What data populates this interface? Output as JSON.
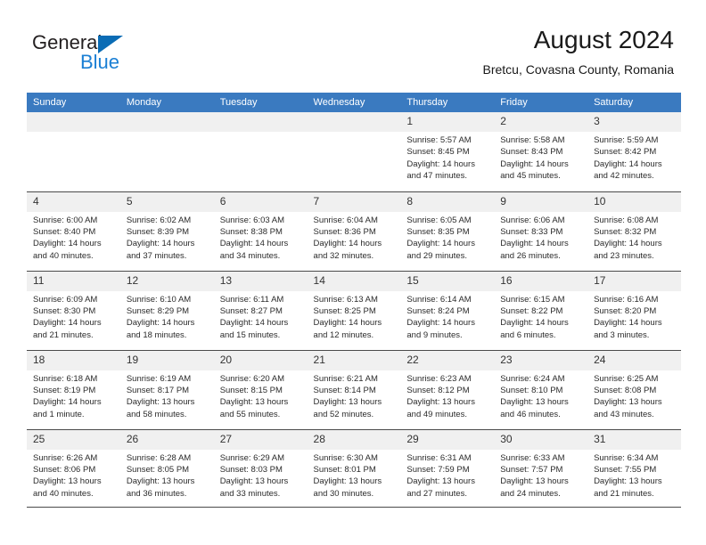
{
  "brand": {
    "name_part1": "General",
    "name_part2": "Blue",
    "triangle_color": "#0a6cb5",
    "blue_color": "#1a7fd4"
  },
  "header": {
    "title": "August 2024",
    "subtitle": "Bretcu, Covasna County, Romania"
  },
  "theme": {
    "header_bg": "#3a7ac0",
    "daynum_bg": "#f0f0f0",
    "rule_color": "#4a4a4a",
    "text_color": "#2b2b2b"
  },
  "weekdays": [
    "Sunday",
    "Monday",
    "Tuesday",
    "Wednesday",
    "Thursday",
    "Friday",
    "Saturday"
  ],
  "weeks": [
    [
      {
        "day": "",
        "lines": []
      },
      {
        "day": "",
        "lines": []
      },
      {
        "day": "",
        "lines": []
      },
      {
        "day": "",
        "lines": []
      },
      {
        "day": "1",
        "lines": [
          "Sunrise: 5:57 AM",
          "Sunset: 8:45 PM",
          "Daylight: 14 hours",
          "and 47 minutes."
        ]
      },
      {
        "day": "2",
        "lines": [
          "Sunrise: 5:58 AM",
          "Sunset: 8:43 PM",
          "Daylight: 14 hours",
          "and 45 minutes."
        ]
      },
      {
        "day": "3",
        "lines": [
          "Sunrise: 5:59 AM",
          "Sunset: 8:42 PM",
          "Daylight: 14 hours",
          "and 42 minutes."
        ]
      }
    ],
    [
      {
        "day": "4",
        "lines": [
          "Sunrise: 6:00 AM",
          "Sunset: 8:40 PM",
          "Daylight: 14 hours",
          "and 40 minutes."
        ]
      },
      {
        "day": "5",
        "lines": [
          "Sunrise: 6:02 AM",
          "Sunset: 8:39 PM",
          "Daylight: 14 hours",
          "and 37 minutes."
        ]
      },
      {
        "day": "6",
        "lines": [
          "Sunrise: 6:03 AM",
          "Sunset: 8:38 PM",
          "Daylight: 14 hours",
          "and 34 minutes."
        ]
      },
      {
        "day": "7",
        "lines": [
          "Sunrise: 6:04 AM",
          "Sunset: 8:36 PM",
          "Daylight: 14 hours",
          "and 32 minutes."
        ]
      },
      {
        "day": "8",
        "lines": [
          "Sunrise: 6:05 AM",
          "Sunset: 8:35 PM",
          "Daylight: 14 hours",
          "and 29 minutes."
        ]
      },
      {
        "day": "9",
        "lines": [
          "Sunrise: 6:06 AM",
          "Sunset: 8:33 PM",
          "Daylight: 14 hours",
          "and 26 minutes."
        ]
      },
      {
        "day": "10",
        "lines": [
          "Sunrise: 6:08 AM",
          "Sunset: 8:32 PM",
          "Daylight: 14 hours",
          "and 23 minutes."
        ]
      }
    ],
    [
      {
        "day": "11",
        "lines": [
          "Sunrise: 6:09 AM",
          "Sunset: 8:30 PM",
          "Daylight: 14 hours",
          "and 21 minutes."
        ]
      },
      {
        "day": "12",
        "lines": [
          "Sunrise: 6:10 AM",
          "Sunset: 8:29 PM",
          "Daylight: 14 hours",
          "and 18 minutes."
        ]
      },
      {
        "day": "13",
        "lines": [
          "Sunrise: 6:11 AM",
          "Sunset: 8:27 PM",
          "Daylight: 14 hours",
          "and 15 minutes."
        ]
      },
      {
        "day": "14",
        "lines": [
          "Sunrise: 6:13 AM",
          "Sunset: 8:25 PM",
          "Daylight: 14 hours",
          "and 12 minutes."
        ]
      },
      {
        "day": "15",
        "lines": [
          "Sunrise: 6:14 AM",
          "Sunset: 8:24 PM",
          "Daylight: 14 hours",
          "and 9 minutes."
        ]
      },
      {
        "day": "16",
        "lines": [
          "Sunrise: 6:15 AM",
          "Sunset: 8:22 PM",
          "Daylight: 14 hours",
          "and 6 minutes."
        ]
      },
      {
        "day": "17",
        "lines": [
          "Sunrise: 6:16 AM",
          "Sunset: 8:20 PM",
          "Daylight: 14 hours",
          "and 3 minutes."
        ]
      }
    ],
    [
      {
        "day": "18",
        "lines": [
          "Sunrise: 6:18 AM",
          "Sunset: 8:19 PM",
          "Daylight: 14 hours",
          "and 1 minute."
        ]
      },
      {
        "day": "19",
        "lines": [
          "Sunrise: 6:19 AM",
          "Sunset: 8:17 PM",
          "Daylight: 13 hours",
          "and 58 minutes."
        ]
      },
      {
        "day": "20",
        "lines": [
          "Sunrise: 6:20 AM",
          "Sunset: 8:15 PM",
          "Daylight: 13 hours",
          "and 55 minutes."
        ]
      },
      {
        "day": "21",
        "lines": [
          "Sunrise: 6:21 AM",
          "Sunset: 8:14 PM",
          "Daylight: 13 hours",
          "and 52 minutes."
        ]
      },
      {
        "day": "22",
        "lines": [
          "Sunrise: 6:23 AM",
          "Sunset: 8:12 PM",
          "Daylight: 13 hours",
          "and 49 minutes."
        ]
      },
      {
        "day": "23",
        "lines": [
          "Sunrise: 6:24 AM",
          "Sunset: 8:10 PM",
          "Daylight: 13 hours",
          "and 46 minutes."
        ]
      },
      {
        "day": "24",
        "lines": [
          "Sunrise: 6:25 AM",
          "Sunset: 8:08 PM",
          "Daylight: 13 hours",
          "and 43 minutes."
        ]
      }
    ],
    [
      {
        "day": "25",
        "lines": [
          "Sunrise: 6:26 AM",
          "Sunset: 8:06 PM",
          "Daylight: 13 hours",
          "and 40 minutes."
        ]
      },
      {
        "day": "26",
        "lines": [
          "Sunrise: 6:28 AM",
          "Sunset: 8:05 PM",
          "Daylight: 13 hours",
          "and 36 minutes."
        ]
      },
      {
        "day": "27",
        "lines": [
          "Sunrise: 6:29 AM",
          "Sunset: 8:03 PM",
          "Daylight: 13 hours",
          "and 33 minutes."
        ]
      },
      {
        "day": "28",
        "lines": [
          "Sunrise: 6:30 AM",
          "Sunset: 8:01 PM",
          "Daylight: 13 hours",
          "and 30 minutes."
        ]
      },
      {
        "day": "29",
        "lines": [
          "Sunrise: 6:31 AM",
          "Sunset: 7:59 PM",
          "Daylight: 13 hours",
          "and 27 minutes."
        ]
      },
      {
        "day": "30",
        "lines": [
          "Sunrise: 6:33 AM",
          "Sunset: 7:57 PM",
          "Daylight: 13 hours",
          "and 24 minutes."
        ]
      },
      {
        "day": "31",
        "lines": [
          "Sunrise: 6:34 AM",
          "Sunset: 7:55 PM",
          "Daylight: 13 hours",
          "and 21 minutes."
        ]
      }
    ]
  ]
}
